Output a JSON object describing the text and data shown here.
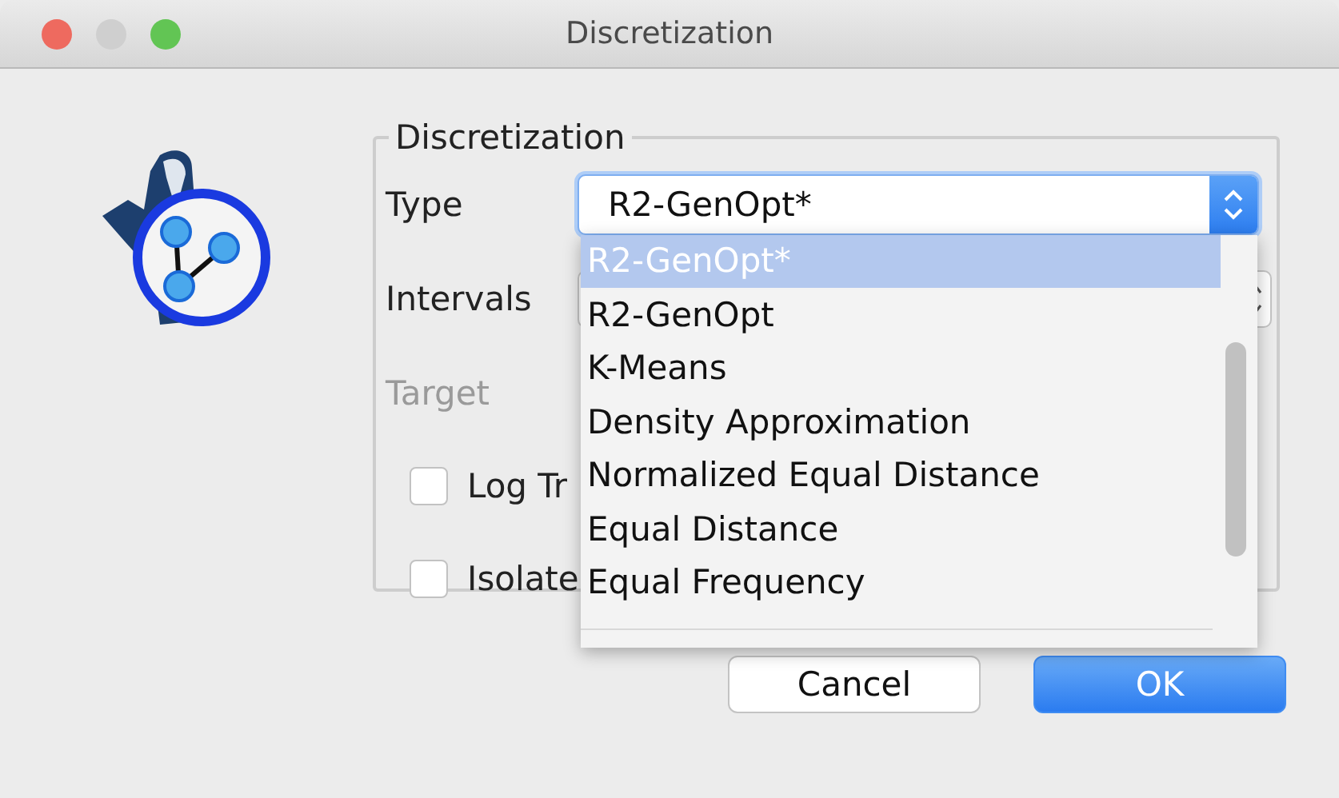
{
  "window": {
    "title": "Discretization"
  },
  "group": {
    "title": "Discretization"
  },
  "fields": [
    {
      "label": "Type",
      "kind": "combo",
      "value": "R2-GenOpt*",
      "disabled": false
    },
    {
      "label": "Intervals",
      "kind": "spinner",
      "disabled": false
    },
    {
      "label": "Target",
      "kind": "none",
      "disabled": true
    }
  ],
  "checkboxes": [
    {
      "label": "Log Tr",
      "checked": false
    },
    {
      "label": "Isolate",
      "checked": false
    }
  ],
  "dropdown": {
    "items": [
      {
        "label": "R2-GenOpt*",
        "selected": true
      },
      {
        "label": "R2-GenOpt",
        "selected": false
      },
      {
        "label": "K-Means",
        "selected": false
      },
      {
        "label": "Density Approximation",
        "selected": false
      },
      {
        "label": "Normalized Equal Distance",
        "selected": false
      },
      {
        "label": "Equal Distance",
        "selected": false
      },
      {
        "label": "Equal Frequency",
        "selected": false
      }
    ]
  },
  "buttons": [
    {
      "label": "Cancel",
      "kind": "default"
    },
    {
      "label": "OK",
      "kind": "primary"
    }
  ]
}
